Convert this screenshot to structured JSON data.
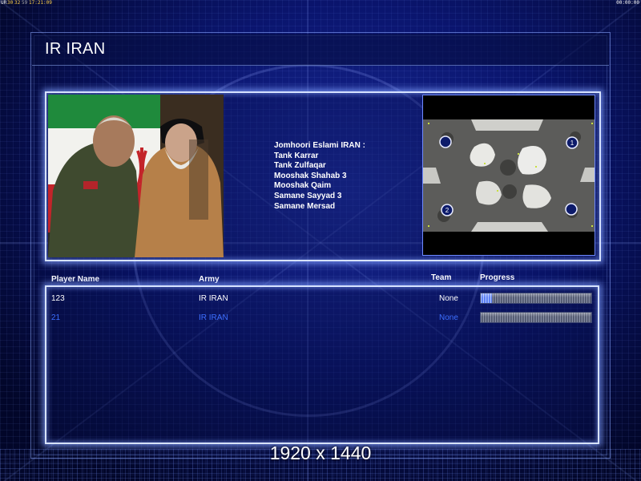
{
  "status_bar": {
    "left_items": [
      "UR",
      "30",
      "32",
      "59",
      "17:21:09"
    ],
    "right_text": "00:00:00"
  },
  "title": "IR IRAN",
  "portrait": {
    "icon": "faction-portrait-image"
  },
  "army_info": {
    "heading": "Jomhoori Eslami IRAN :",
    "units": [
      "Tank Karrar",
      "Tank Zulfaqar",
      "Mooshak Shahab 3",
      "Mooshak Qaim",
      "Samane Sayyad 3",
      "Samane Mersad"
    ]
  },
  "minimap": {
    "start_positions": [
      {
        "label": ""
      },
      {
        "label": "1"
      },
      {
        "label": "2"
      },
      {
        "label": ""
      }
    ]
  },
  "table": {
    "headers": {
      "name": "Player Name",
      "army": "Army",
      "team": "Team",
      "progress": "Progress"
    },
    "rows": [
      {
        "name": "123",
        "army": "IR IRAN",
        "team": "None",
        "progress": 0.1,
        "color": "#ffffff"
      },
      {
        "name": "21",
        "army": "IR IRAN",
        "team": "None",
        "progress": 0.0,
        "color": "#3d6fff"
      }
    ]
  },
  "resolution_label": "1920 x 1440"
}
